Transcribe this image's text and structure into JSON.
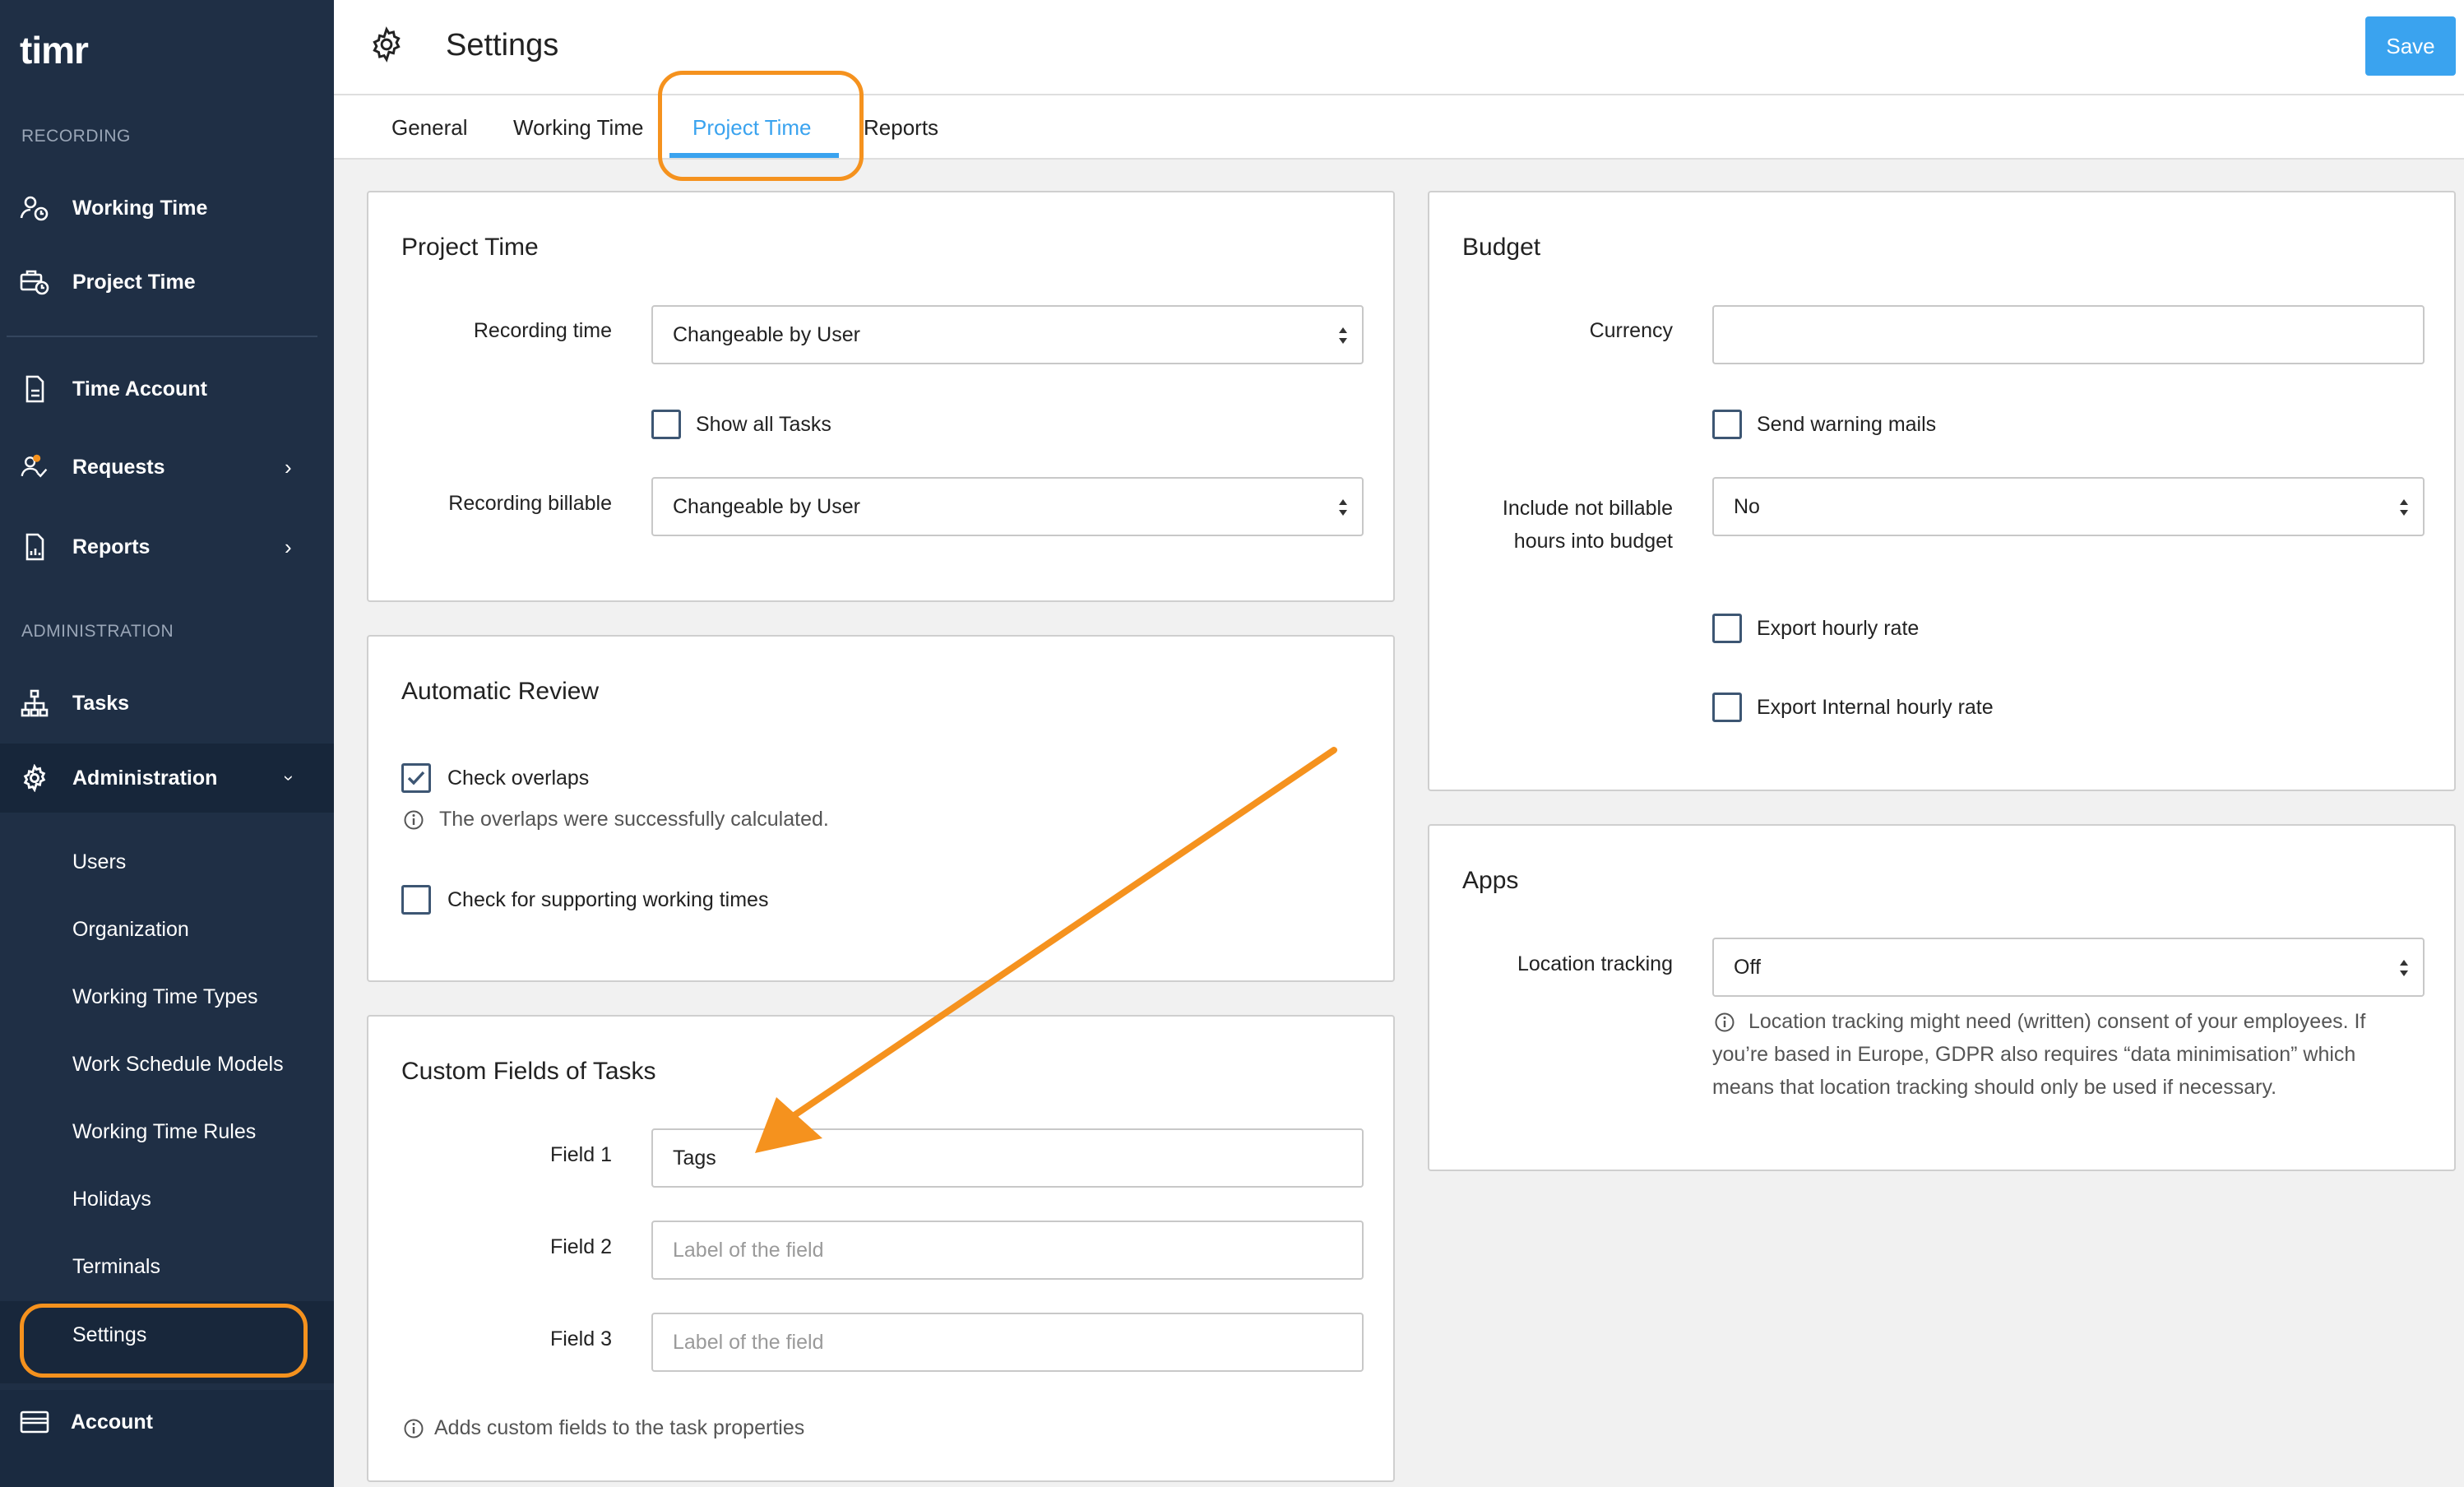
{
  "app": {
    "logo": "timr"
  },
  "sidebar": {
    "recording_label": "RECORDING",
    "admin_label": "ADMINISTRATION",
    "items": [
      {
        "label": "Working Time",
        "icon": "user-clock-icon"
      },
      {
        "label": "Project Time",
        "icon": "briefcase-clock-icon"
      },
      {
        "label": "Time Account",
        "icon": "document-icon"
      },
      {
        "label": "Requests",
        "icon": "user-check-icon"
      },
      {
        "label": "Reports",
        "icon": "report-icon"
      },
      {
        "label": "Tasks",
        "icon": "hierarchy-icon"
      },
      {
        "label": "Administration",
        "icon": "gear-icon"
      }
    ],
    "sub_items": [
      "Users",
      "Organization",
      "Working Time Types",
      "Work Schedule Models",
      "Working Time Rules",
      "Holidays",
      "Terminals",
      "Settings"
    ],
    "account_label": "Account",
    "badge_color": "#f5921e"
  },
  "header": {
    "title": "Settings",
    "save_label": "Save"
  },
  "tabs": [
    "General",
    "Working Time",
    "Project Time",
    "Reports"
  ],
  "active_tab": "Project Time",
  "project_time": {
    "title": "Project Time",
    "recording_time_label": "Recording time",
    "recording_time_value": "Changeable by User",
    "show_all_tasks_label": "Show all Tasks",
    "recording_billable_label": "Recording billable",
    "recording_billable_value": "Changeable by User"
  },
  "automatic_review": {
    "title": "Automatic Review",
    "check_overlaps_label": "Check overlaps",
    "check_overlaps_checked": true,
    "overlaps_info": "The overlaps were successfully calculated.",
    "supporting_label": "Check for supporting working times"
  },
  "custom_fields": {
    "title": "Custom Fields of Tasks",
    "field1_label": "Field 1",
    "field1_value": "Tags",
    "field2_label": "Field 2",
    "field3_label": "Field 3",
    "placeholder": "Label of the field",
    "info": "Adds custom fields to the task properties"
  },
  "budget": {
    "title": "Budget",
    "currency_label": "Currency",
    "currency_value": "",
    "send_warning_label": "Send warning mails",
    "include_label_1": "Include not billable",
    "include_label_2": "hours into budget",
    "include_value": "No",
    "export_hourly_label": "Export hourly rate",
    "export_internal_label": "Export Internal hourly rate"
  },
  "apps": {
    "title": "Apps",
    "location_label": "Location tracking",
    "location_value": "Off",
    "info_line1": "Location tracking might need (written) consent of your employees. If",
    "info_line2": "you’re based in Europe, GDPR also requires “data minimisation” which",
    "info_line3": "means that location tracking should only be used if necessary."
  },
  "colors": {
    "accent": "#3aa3ef",
    "highlight": "#f5921e",
    "sidebar": "#1f2f45"
  }
}
